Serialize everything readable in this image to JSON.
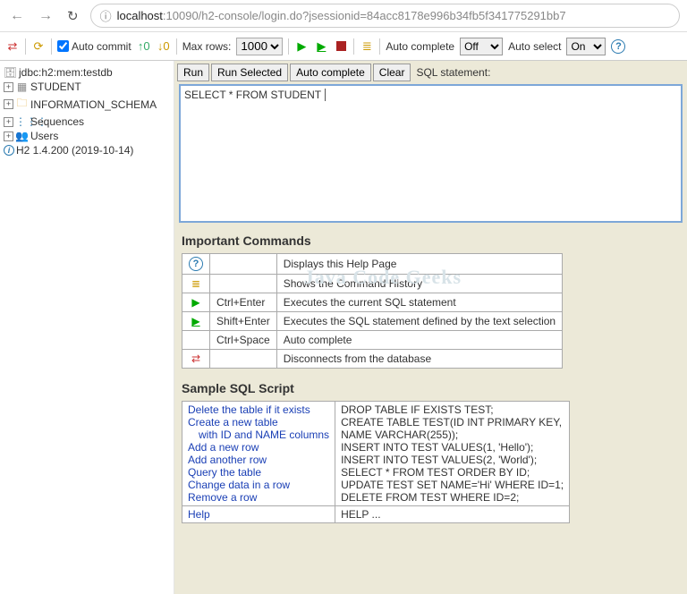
{
  "browser": {
    "host": "localhost",
    "rest": ":10090/h2-console/login.do?jsessionid=84acc8178e996b34fb5f341775291bb7"
  },
  "toolbar": {
    "auto_commit": "Auto commit",
    "max_rows": "Max rows:",
    "max_rows_value": "1000",
    "auto_complete": "Auto complete",
    "auto_complete_value": "Off",
    "auto_select": "Auto select",
    "auto_select_value": "On"
  },
  "tree": {
    "db": "jdbc:h2:mem:testdb",
    "student": "STUDENT",
    "info_schema": "INFORMATION_SCHEMA",
    "sequences": "Sequences",
    "users": "Users",
    "version": "H2 1.4.200 (2019-10-14)"
  },
  "sql": {
    "run": "Run",
    "run_selected": "Run Selected",
    "auto_complete": "Auto complete",
    "clear": "Clear",
    "label": "SQL statement:",
    "value": "SELECT * FROM STUDENT"
  },
  "sections": {
    "commands_title": "Important Commands",
    "script_title": "Sample SQL Script"
  },
  "commands": [
    {
      "icon": "?",
      "shortcut": "",
      "desc": "Displays this Help Page"
    },
    {
      "icon": "≣",
      "shortcut": "",
      "desc": "Shows the Command History"
    },
    {
      "icon": "▶",
      "shortcut": "Ctrl+Enter",
      "desc": "Executes the current SQL statement"
    },
    {
      "icon": "▶̲",
      "shortcut": "Shift+Enter",
      "desc": "Executes the SQL statement defined by the text selection"
    },
    {
      "icon": "",
      "shortcut": "Ctrl+Space",
      "desc": "Auto complete"
    },
    {
      "icon": "⇄",
      "shortcut": "",
      "desc": "Disconnects from the database"
    }
  ],
  "scripts": [
    {
      "label": "Delete the table if it exists",
      "sql": "DROP TABLE IF EXISTS TEST;"
    },
    {
      "label": "Create a new table",
      "sql": "CREATE TABLE TEST(ID INT PRIMARY KEY,"
    },
    {
      "label": "with ID and NAME columns",
      "indent": true,
      "sql": "   NAME VARCHAR(255));"
    },
    {
      "label": "Add a new row",
      "sql": "INSERT INTO TEST VALUES(1, 'Hello');"
    },
    {
      "label": "Add another row",
      "sql": "INSERT INTO TEST VALUES(2, 'World');"
    },
    {
      "label": "Query the table",
      "sql": "SELECT * FROM TEST ORDER BY ID;"
    },
    {
      "label": "Change data in a row",
      "sql": "UPDATE TEST SET NAME='Hi' WHERE ID=1;"
    },
    {
      "label": "Remove a row",
      "sql": "DELETE FROM TEST WHERE ID=2;"
    }
  ],
  "help_row": {
    "label": "Help",
    "sql": "HELP ..."
  },
  "watermark": "Java Code Geeks"
}
